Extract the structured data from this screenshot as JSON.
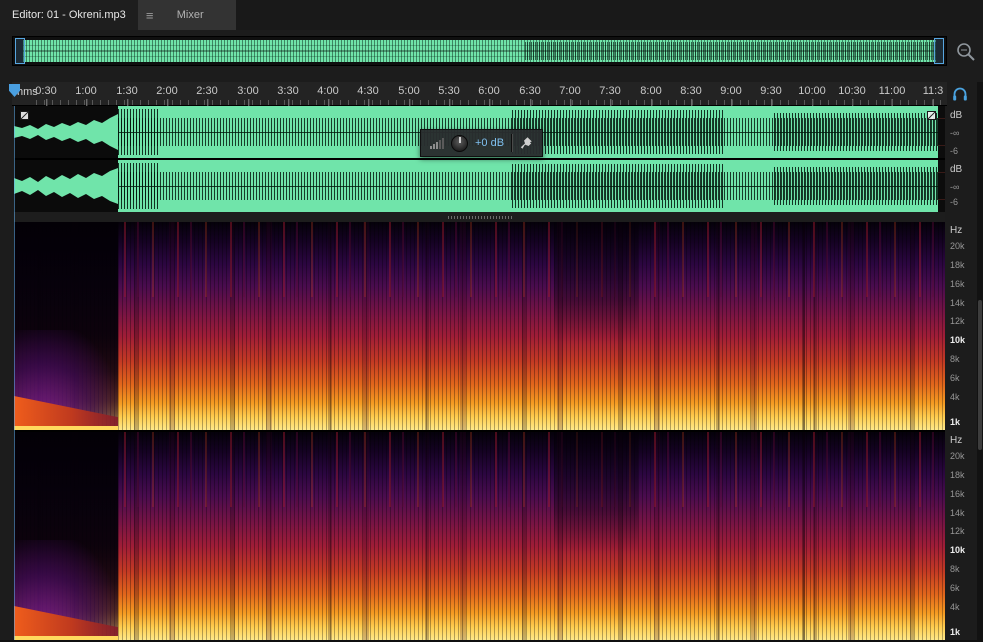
{
  "tabs": {
    "editor_label": "Editor: 01 - Okreni.mp3",
    "mixer_label": "Mixer",
    "menu_glyph": "≡"
  },
  "timeline": {
    "unit": "hms",
    "ticks": [
      "0:30",
      "1:00",
      "1:30",
      "2:00",
      "2:30",
      "3:00",
      "3:30",
      "4:00",
      "4:30",
      "5:00",
      "5:30",
      "6:00",
      "6:30",
      "7:00",
      "7:30",
      "8:00",
      "8:30",
      "9:00",
      "9:30",
      "10:00",
      "10:30",
      "11:00",
      "11:3"
    ]
  },
  "hud": {
    "gain": "+0 dB"
  },
  "waveform_scale": {
    "db": "dB",
    "inf": "-∞",
    "minus6": "-6"
  },
  "spectrogram_scale": {
    "hz": "Hz",
    "ticks": [
      "20k",
      "18k",
      "16k",
      "14k",
      "12k",
      "10k",
      "8k",
      "6k",
      "4k",
      "1k"
    ]
  },
  "icons": {
    "menu": "panel-menu-icon",
    "zoom": "zoom-navigator-icon",
    "monitor": "headphones-icon",
    "knob": "volume-knob",
    "meter": "level-meter-icon",
    "pin": "pin-icon"
  },
  "colors": {
    "waveform_green": "#70e4aa",
    "accent_blue": "#4a9fe0",
    "hud_gain_text": "#7fc1f0",
    "spectro_bottom": "#ffe98a",
    "spectro_mid": "#c43a24",
    "spectro_top": "#05010a",
    "panel_bg": "#1e1e1e"
  }
}
